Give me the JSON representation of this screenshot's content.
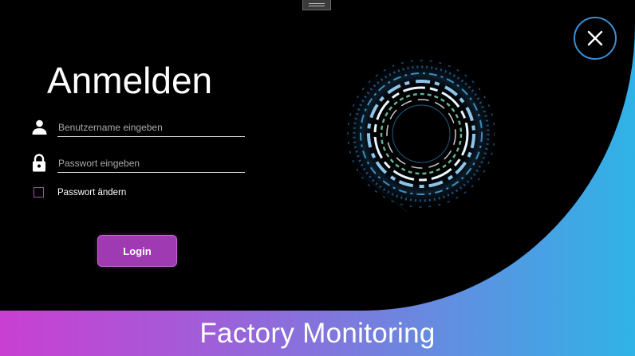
{
  "header": {
    "title": "Anmelden"
  },
  "form": {
    "username_placeholder": "Benutzername eingeben",
    "password_placeholder": "Passwort eingeben",
    "change_password_label": "Passwort ändern",
    "change_password_checked": false,
    "login_label": "Login"
  },
  "footer": {
    "app_name": "Factory Monitoring"
  },
  "icons": {
    "user": "user-icon",
    "lock": "lock-icon",
    "close": "close-icon",
    "drag": "drag-handle-icon"
  },
  "colors": {
    "background": "#000000",
    "accent": "#a03ab3",
    "close_ring": "#3a8fd8",
    "gradient_start": "#c93fd2",
    "gradient_end": "#2fb3e6"
  }
}
